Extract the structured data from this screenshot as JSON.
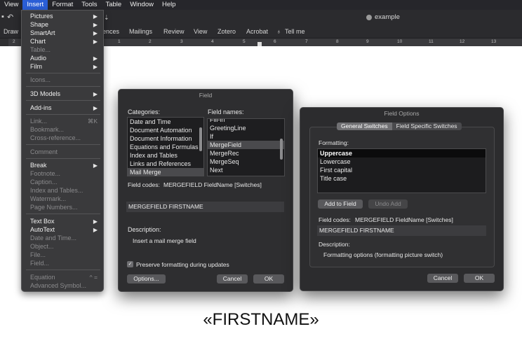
{
  "menubar": [
    "View",
    "Insert",
    "Format",
    "Tools",
    "Table",
    "Window",
    "Help"
  ],
  "document_title": "example",
  "ribbon_tabs": [
    "Draw",
    "ences",
    "Mailings",
    "Review",
    "View",
    "Zotero",
    "Acrobat",
    "Tell me"
  ],
  "ruler_numbers": [
    "2",
    "1",
    "1",
    "2",
    "3",
    "4",
    "5",
    "6",
    "7",
    "8",
    "9",
    "10",
    "11",
    "12",
    "13"
  ],
  "insert_menu": {
    "items": [
      {
        "label": "Pictures",
        "enabled": true,
        "submenu": true
      },
      {
        "label": "Shape",
        "enabled": true,
        "submenu": true
      },
      {
        "label": "SmartArt",
        "enabled": true,
        "submenu": true
      },
      {
        "label": "Chart",
        "enabled": true,
        "submenu": true
      },
      {
        "label": "Table...",
        "enabled": false
      },
      {
        "label": "Audio",
        "enabled": true,
        "submenu": true
      },
      {
        "label": "Film",
        "enabled": true,
        "submenu": true
      },
      {
        "label": "Icons...",
        "enabled": false
      },
      {
        "label": "3D Models",
        "enabled": true,
        "submenu": true
      },
      {
        "label": "Add-ins",
        "enabled": true,
        "submenu": true
      },
      {
        "label": "Link...",
        "enabled": false,
        "shortcut": "⌘K"
      },
      {
        "label": "Bookmark...",
        "enabled": false
      },
      {
        "label": "Cross-reference...",
        "enabled": false
      },
      {
        "label": "Comment",
        "enabled": false
      },
      {
        "label": "Break",
        "enabled": true,
        "submenu": true
      },
      {
        "label": "Footnote...",
        "enabled": false
      },
      {
        "label": "Caption...",
        "enabled": false
      },
      {
        "label": "Index and Tables...",
        "enabled": false
      },
      {
        "label": "Watermark...",
        "enabled": false
      },
      {
        "label": "Page Numbers...",
        "enabled": false
      },
      {
        "label": "Text Box",
        "enabled": true,
        "submenu": true
      },
      {
        "label": "AutoText",
        "enabled": true,
        "submenu": true
      },
      {
        "label": "Date and Time...",
        "enabled": false
      },
      {
        "label": "Object...",
        "enabled": false
      },
      {
        "label": "File...",
        "enabled": false
      },
      {
        "label": "Field...",
        "enabled": false
      },
      {
        "label": "Equation",
        "enabled": false,
        "shortcut": "^ ="
      },
      {
        "label": "Advanced Symbol...",
        "enabled": false
      }
    ]
  },
  "field_dialog": {
    "title": "Field",
    "categories_label": "Categories:",
    "categories": [
      "Date and Time",
      "Document Automation",
      "Document Information",
      "Equations and Formulas",
      "Index and Tables",
      "Links and References",
      "Mail Merge"
    ],
    "categories_selected": "Mail Merge",
    "field_names_label": "Field names:",
    "field_names": [
      "Fill-in",
      "GreetingLine",
      "If",
      "MergeField",
      "MergeRec",
      "MergeSeq",
      "Next"
    ],
    "field_names_selected": "MergeField",
    "field_codes_label": "Field codes:",
    "field_codes_syntax": "MERGEFIELD FieldName [Switches]",
    "field_code_value": "MERGEFIELD FIRSTNAME",
    "description_label": "Description:",
    "description": "Insert a mail merge field",
    "preserve_label": "Preserve formatting during updates",
    "preserve_checked": "✓",
    "options_button": "Options...",
    "cancel_button": "Cancel",
    "ok_button": "OK"
  },
  "field_options_dialog": {
    "title": "Field Options",
    "tab_general": "General Switches",
    "tab_specific": "Field Specific Switches",
    "formatting_label": "Formatting:",
    "formatting_options": [
      "Uppercase",
      "Lowercase",
      "First capital",
      "Title case"
    ],
    "formatting_selected": "Uppercase",
    "add_to_field_button": "Add to Field",
    "undo_add_button": "Undo Add",
    "field_codes_label": "Field codes:",
    "field_codes_syntax": "MERGEFIELD FieldName [Switches]",
    "field_code_value": "MERGEFIELD FIRSTNAME",
    "description_label": "Description:",
    "description": "Formatting options (formatting picture switch)",
    "cancel_button": "Cancel",
    "ok_button": "OK"
  },
  "document_merge_field": "«FIRSTNAME»",
  "colors": {
    "accent": "#2a5ed6",
    "dialog_bg": "#2e2e30",
    "menu_bg": "#3a3a3c"
  }
}
